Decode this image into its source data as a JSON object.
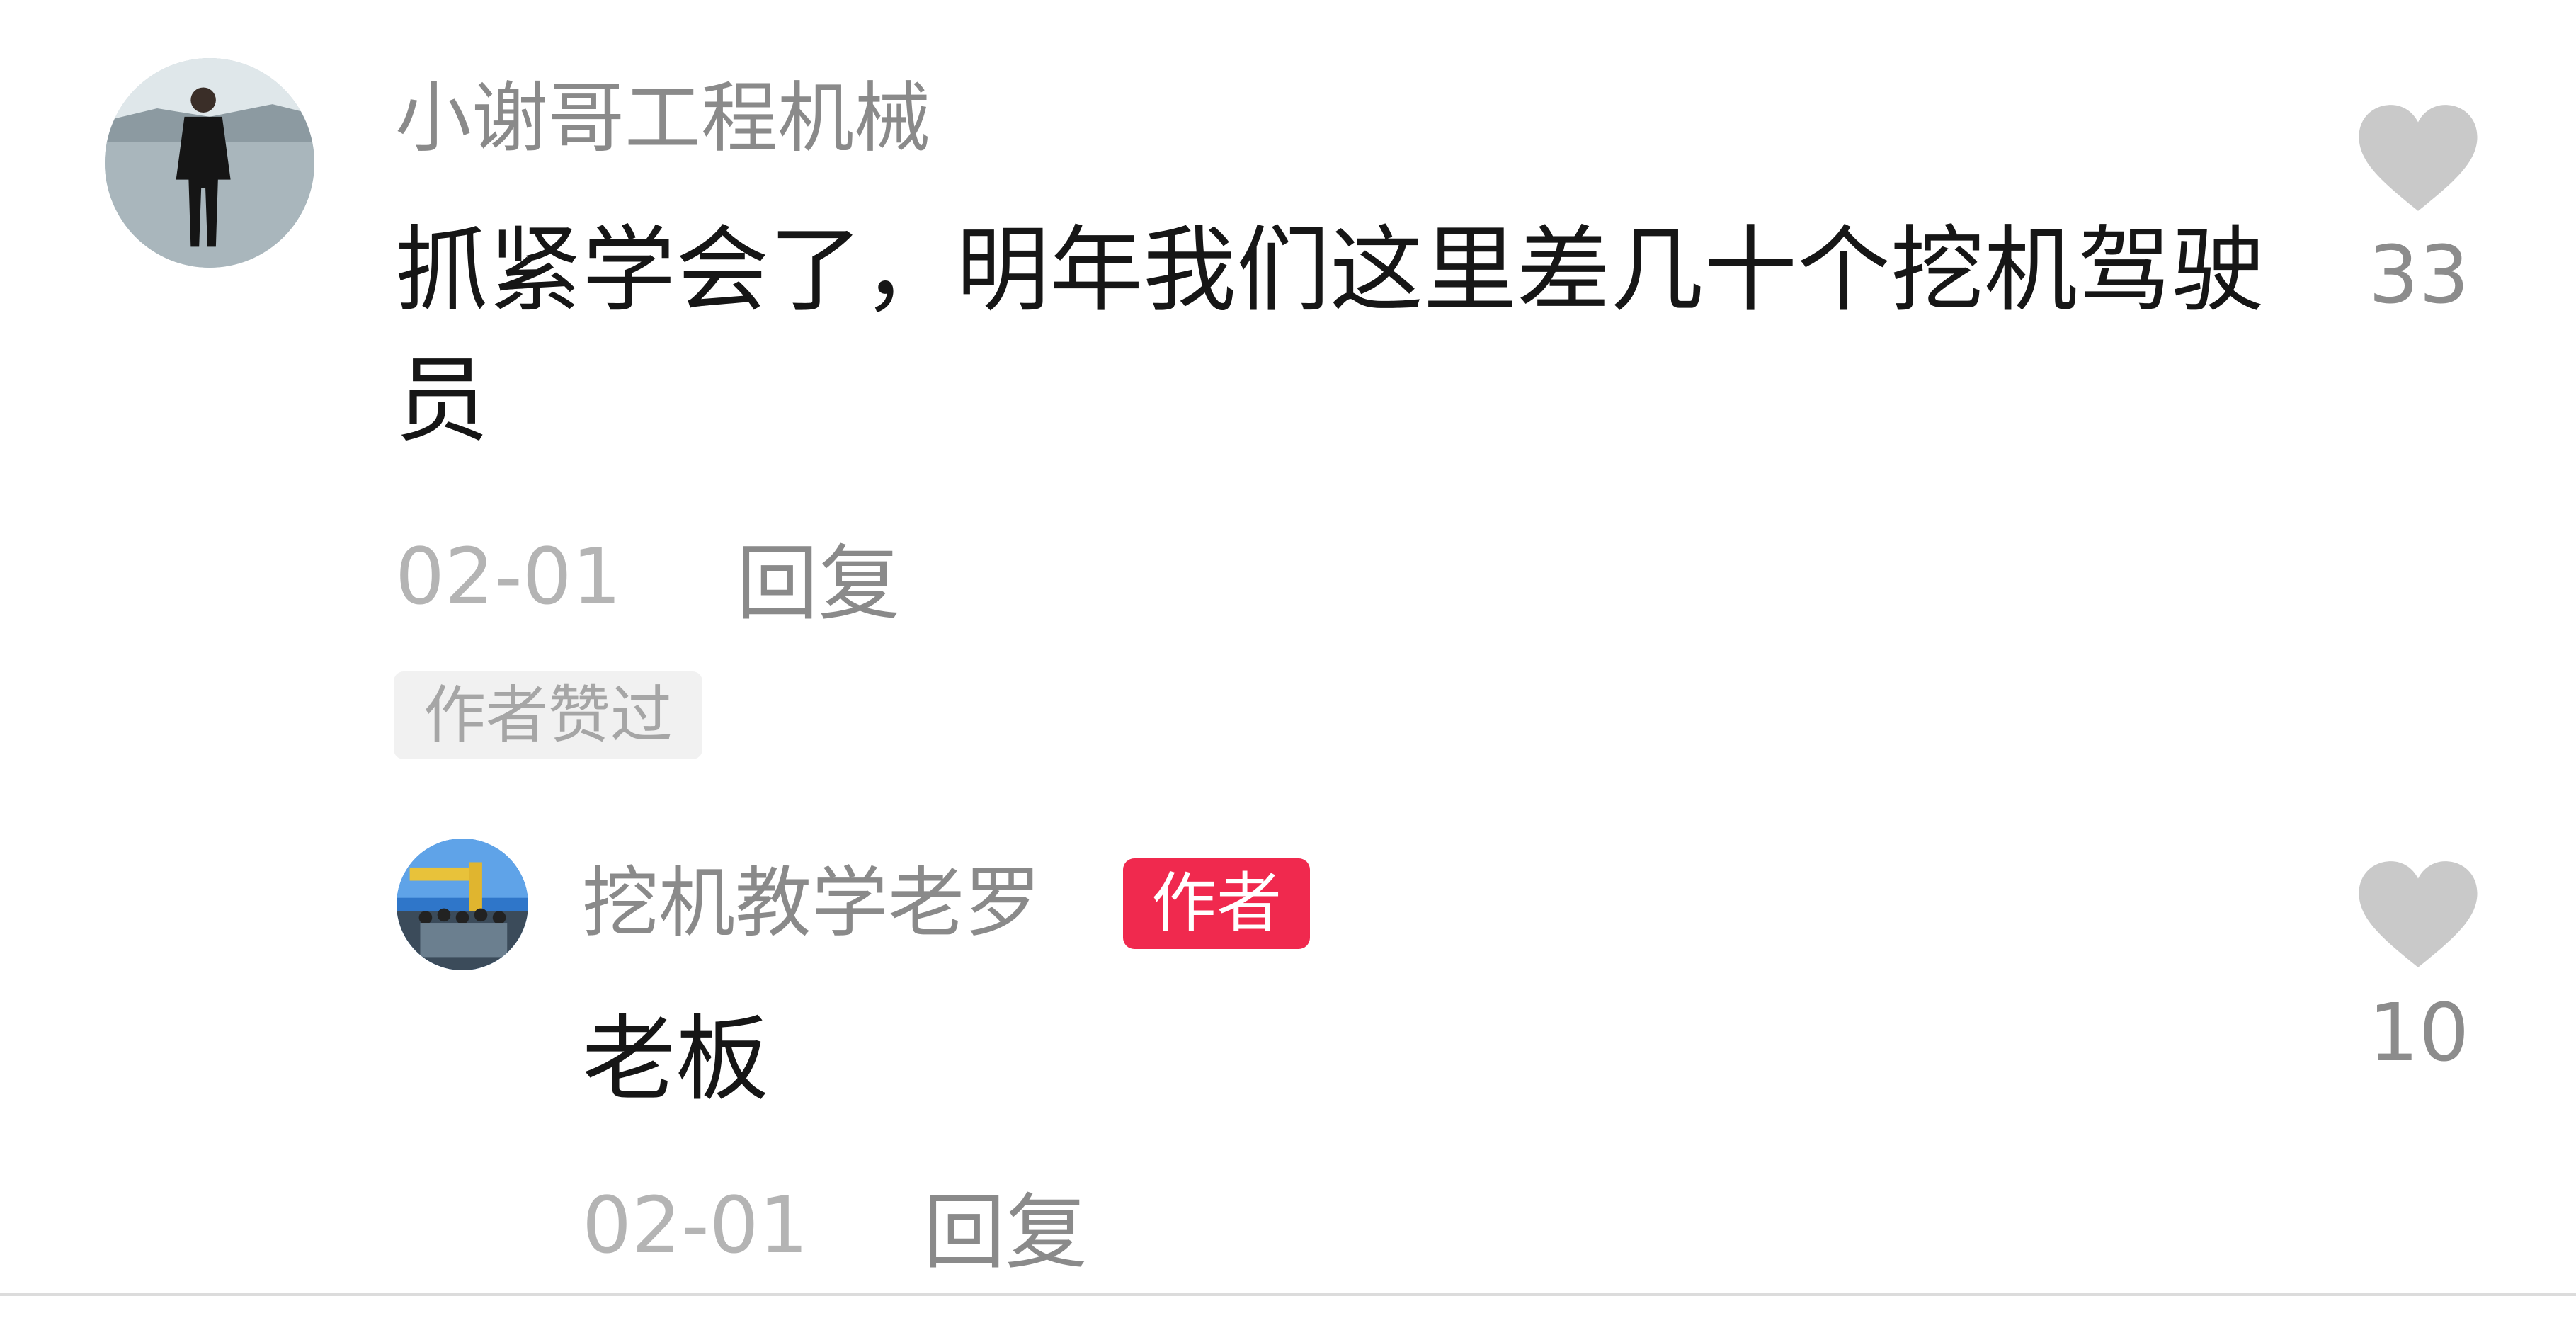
{
  "comments": [
    {
      "username": "小谢哥工程机械",
      "text": "抓紧学会了，明年我们这里差几十个挖机驾驶员",
      "date": "02-01",
      "reply_label": "回复",
      "liked_by_author_label": "作者赞过",
      "like_count": "33"
    }
  ],
  "replies": [
    {
      "username": "挖机教学老罗",
      "author_tag": "作者",
      "text": "老板",
      "date": "02-01",
      "reply_label": "回复",
      "like_count": "10"
    }
  ],
  "icons": {
    "like": "heart-icon",
    "avatar": "avatar-image"
  },
  "colors": {
    "author_tag_bg": "#f0294e",
    "heart_gray": "#c9c9c9",
    "username_gray": "#8a8a8a"
  }
}
